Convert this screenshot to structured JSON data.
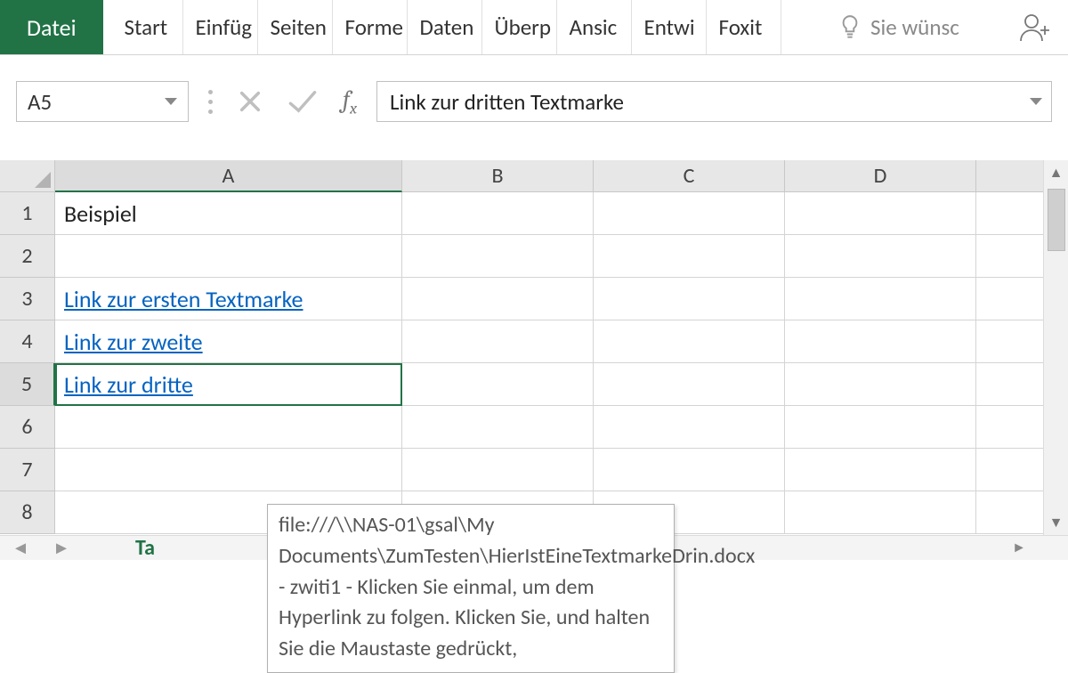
{
  "ribbon": {
    "file": "Datei",
    "tabs": [
      "Start",
      "Einfüg",
      "Seiten",
      "Forme",
      "Daten",
      "Überp",
      "Ansic",
      "Entwi",
      "Foxit"
    ],
    "tell_me": "Sie wünsc"
  },
  "name_box": "A5",
  "formula_bar": "Link zur dritten Textmarke",
  "columns": [
    "A",
    "B",
    "C",
    "D"
  ],
  "rows": [
    {
      "n": 1,
      "A": "Beispiel",
      "link": false
    },
    {
      "n": 2,
      "A": "",
      "link": false
    },
    {
      "n": 3,
      "A": "Link zur ersten Textmarke",
      "link": true
    },
    {
      "n": 4,
      "A": "Link zur zweite",
      "link": true
    },
    {
      "n": 5,
      "A": "Link zur dritte",
      "link": true
    },
    {
      "n": 6,
      "A": "",
      "link": false
    },
    {
      "n": 7,
      "A": "",
      "link": false
    },
    {
      "n": 8,
      "A": "",
      "link": false
    }
  ],
  "tooltip": "file:///\\\\NAS-01\\gsal\\My Documents\\ZumTesten\\HierIstEineTextmarkeDrin.docx - zwiti1 - Klicken Sie einmal, um dem Hyperlink zu folgen. Klicken Sie, und halten Sie die Maustaste gedrückt,",
  "sheet_hint": "Ta"
}
